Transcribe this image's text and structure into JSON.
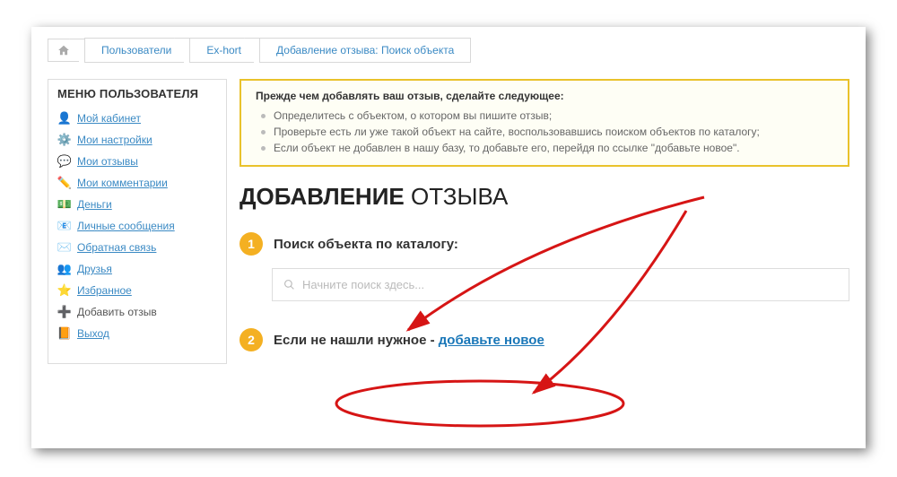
{
  "breadcrumb": {
    "items": [
      "Пользователи",
      "Ex-hort",
      "Добавление отзыва: Поиск объекта"
    ]
  },
  "sidebar": {
    "title": "МЕНЮ ПОЛЬЗОВАТЕЛЯ",
    "items": [
      {
        "icon": "user",
        "label": "Мой кабинет",
        "link": true
      },
      {
        "icon": "gear",
        "label": "Мои настройки",
        "link": true
      },
      {
        "icon": "chat",
        "label": "Мои отзывы",
        "link": true
      },
      {
        "icon": "pencil",
        "label": "Мои комментарии",
        "link": true
      },
      {
        "icon": "money",
        "label": "Деньги",
        "link": true
      },
      {
        "icon": "mail",
        "label": "Личные сообщения",
        "link": true
      },
      {
        "icon": "env",
        "label": "Обратная связь",
        "link": true
      },
      {
        "icon": "friends",
        "label": "Друзья",
        "link": true
      },
      {
        "icon": "star",
        "label": "Избранное",
        "link": true
      },
      {
        "icon": "add",
        "label": "Добавить отзыв",
        "link": false
      },
      {
        "icon": "exit",
        "label": "Выход",
        "link": true
      }
    ]
  },
  "notice": {
    "title": "Прежде чем добавлять ваш отзыв, сделайте следующее:",
    "items": [
      "Определитесь с объектом, о котором вы пишите отзыв;",
      "Проверьте есть ли уже такой объект на сайте, воспользовавшись поиском объектов по каталогу;",
      "Если объект не добавлен в нашу базу, то добавьте его, перейдя по ссылке \"добавьте новое\"."
    ]
  },
  "heading": {
    "bold": "ДОБАВЛЕНИЕ",
    "light": " ОТЗЫВА"
  },
  "step1": {
    "num": "1",
    "label": "Поиск объекта по каталогу:"
  },
  "search": {
    "placeholder": "Начните поиск здесь..."
  },
  "step2": {
    "num": "2",
    "prefix": "Если не нашли нужное - ",
    "link": "добавьте новое"
  }
}
